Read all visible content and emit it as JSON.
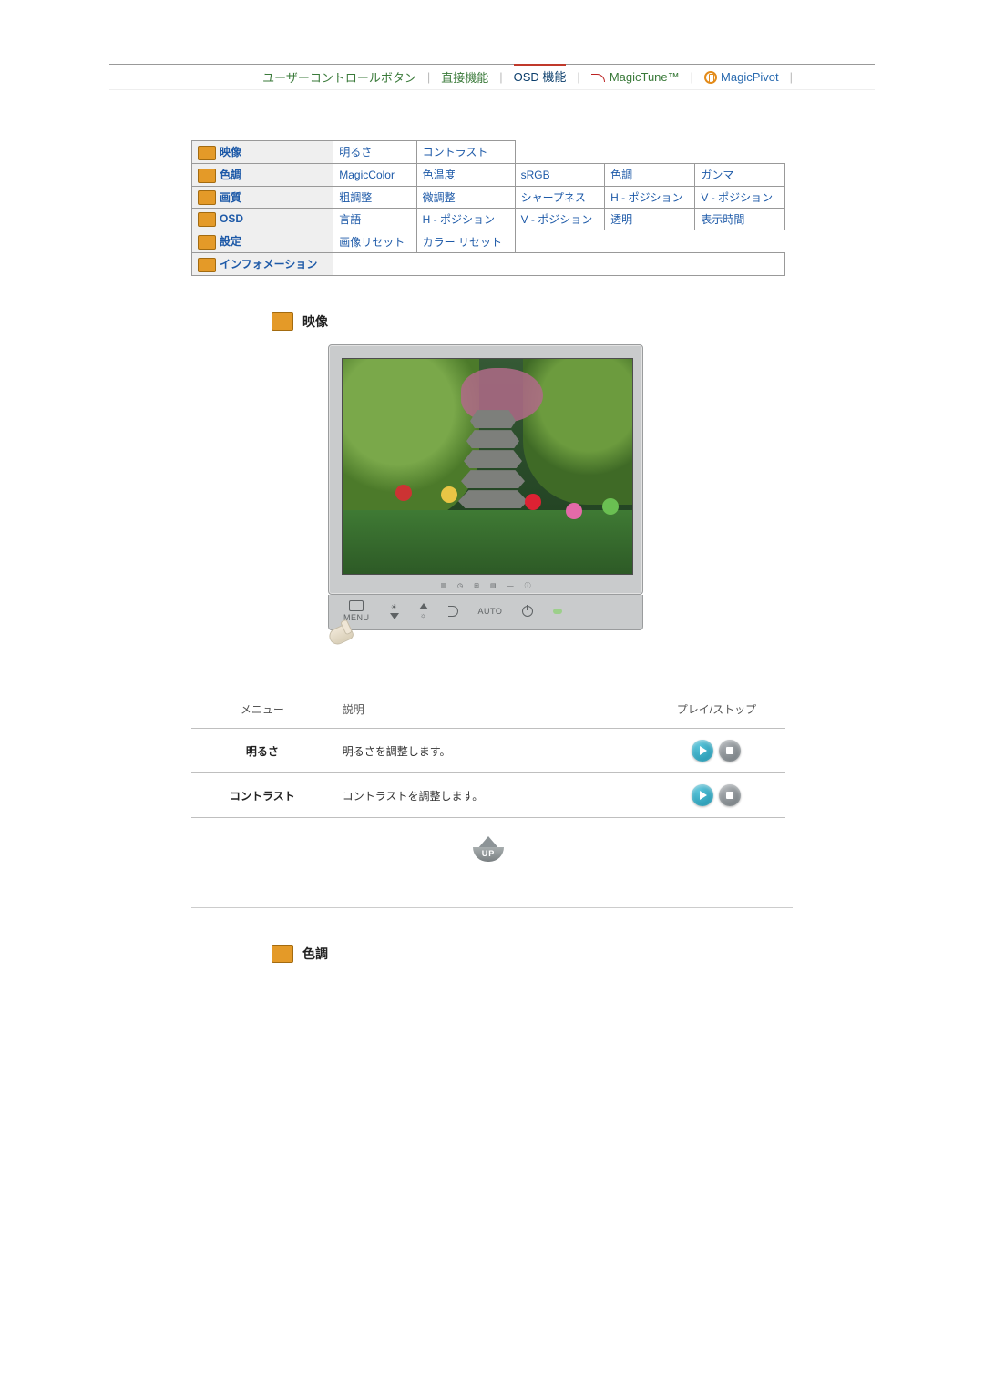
{
  "nav": {
    "user_control": "ユーザーコントロールボタン",
    "direct": "直接機能",
    "osd": "OSD 機能",
    "magictune": "MagicTune™",
    "magicpivot": "MagicPivot"
  },
  "table": {
    "rows": [
      {
        "head": "映像",
        "cells": [
          "明るさ",
          "コントラスト"
        ]
      },
      {
        "head": "色調",
        "cells": [
          "MagicColor",
          "色温度",
          "sRGB",
          "色調",
          "ガンマ"
        ]
      },
      {
        "head": "画質",
        "cells": [
          "粗調整",
          "微調整",
          "シャープネス",
          "H - ポジション",
          "V - ポジション"
        ]
      },
      {
        "head": "OSD",
        "cells": [
          "言語",
          "H - ポジション",
          "V - ポジション",
          "透明",
          "表示時間"
        ]
      },
      {
        "head": "設定",
        "cells": [
          "画像リセット",
          "カラー リセット"
        ]
      },
      {
        "head": "インフォメーション",
        "cells": []
      }
    ]
  },
  "section1": {
    "title": "映像"
  },
  "section2": {
    "title": "色調"
  },
  "monitor_buttons": {
    "menu": "MENU",
    "auto": "AUTO"
  },
  "detail": {
    "head_menu": "メニュー",
    "head_desc": "説明",
    "head_play": "プレイ/ストップ",
    "rows": [
      {
        "name": "明るさ",
        "desc": "明るさを調整します。"
      },
      {
        "name": "コントラスト",
        "desc": "コントラストを調整します。"
      }
    ]
  },
  "up_label": "UP"
}
